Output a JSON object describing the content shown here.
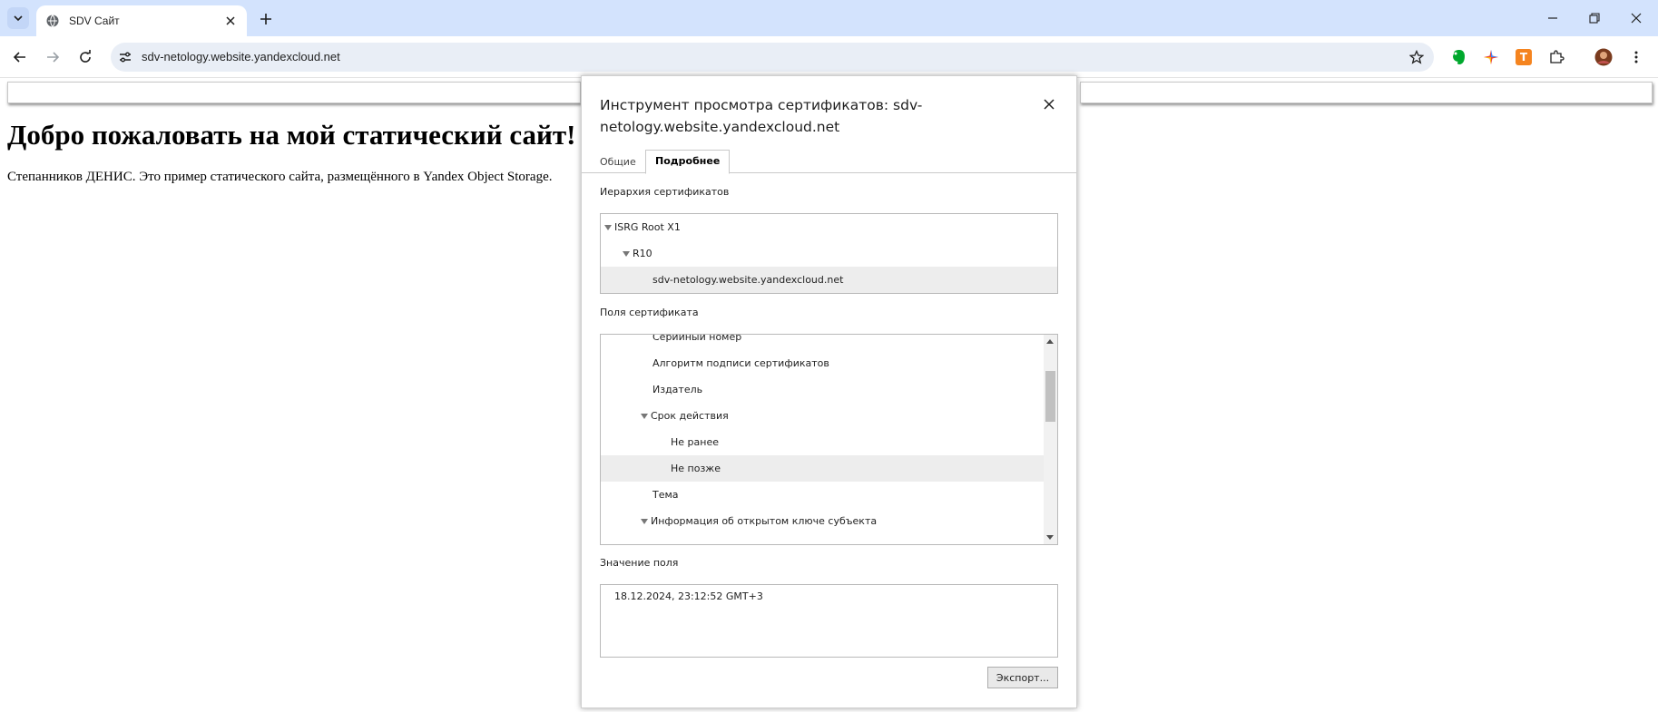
{
  "browser": {
    "tab_title": "SDV Сайт",
    "url": "sdv-netology.website.yandexcloud.net",
    "extension_badge": "T"
  },
  "page": {
    "heading": "Добро пожаловать на мой статический сайт!",
    "paragraph": "Степанников ДЕНИС. Это пример статического сайта, размещённого в Yandex Object Storage."
  },
  "dialog": {
    "title": "Инструмент просмотра сертификатов: sdv-netology.website.yandexcloud.net",
    "tabs": [
      "Общие",
      "Подробнее"
    ],
    "active_tab": "Подробнее",
    "hierarchy_label": "Иерархия сертификатов",
    "hierarchy": [
      {
        "label": "ISRG Root X1"
      },
      {
        "label": "R10"
      },
      {
        "label": "sdv-netology.website.yandexcloud.net"
      }
    ],
    "fields_label": "Поля сертификата",
    "fields": [
      {
        "label": "Серийный номер"
      },
      {
        "label": "Алгоритм подписи сертификатов"
      },
      {
        "label": "Издатель"
      },
      {
        "label": "Срок действия"
      },
      {
        "label": "Не ранее"
      },
      {
        "label": "Не позже"
      },
      {
        "label": "Тема"
      },
      {
        "label": "Информация об открытом ключе субъекта"
      }
    ],
    "value_label": "Значение поля",
    "value": "18.12.2024, 23:12:52 GMT+3",
    "export_button": "Экспорт..."
  },
  "colors": {
    "tabbar_bg": "#d3e3fd",
    "omnibox_bg": "#e9eef6",
    "selected_row_bg": "#ededed"
  }
}
